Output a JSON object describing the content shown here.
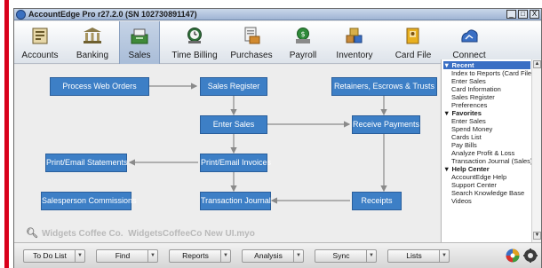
{
  "window": {
    "title": "AccountEdge Pro r27.2.0 (SN 102730891147)",
    "controls": [
      "_",
      "□",
      "X"
    ]
  },
  "toolbar": {
    "items": [
      {
        "label": "Accounts",
        "icon": "accounts-icon"
      },
      {
        "label": "Banking",
        "icon": "banking-icon"
      },
      {
        "label": "Sales",
        "icon": "sales-icon",
        "active": true
      },
      {
        "label": "Time Billing",
        "icon": "time-billing-icon"
      },
      {
        "label": "Purchases",
        "icon": "purchases-icon"
      },
      {
        "label": "Payroll",
        "icon": "payroll-icon"
      },
      {
        "label": "Inventory",
        "icon": "inventory-icon"
      },
      {
        "label": "Card File",
        "icon": "card-file-icon"
      },
      {
        "label": "Connect",
        "icon": "connect-icon"
      }
    ]
  },
  "flow": {
    "process_web_orders": "Process Web Orders",
    "sales_register": "Sales Register",
    "retainers": "Retainers, Escrows & Trusts",
    "enter_sales": "Enter Sales",
    "receive_payments": "Receive Payments",
    "print_email_statements": "Print/Email Statements",
    "print_email_invoices": "Print/Email Invoices",
    "salesperson_commissions": "Salesperson Commissions",
    "transaction_journal": "Transaction Journal",
    "receipts": "Receipts"
  },
  "company": {
    "name": "Widgets Coffee Co.",
    "file": "WidgetsCoffeeCo New UI.myo"
  },
  "sidebar": {
    "recent": {
      "heading": "Recent",
      "items": [
        "Index to Reports (Card File)",
        "Enter Sales",
        "Card Information",
        "Sales Register",
        "Preferences"
      ]
    },
    "favorites": {
      "heading": "Favorites",
      "items": [
        "Enter Sales",
        "Spend Money",
        "Cards List",
        "Pay Bills",
        "Analyze Profit & Loss",
        "Transaction Journal (Sales)"
      ]
    },
    "help": {
      "heading": "Help Center",
      "items": [
        "AccountEdge Help",
        "Support Center",
        "Search Knowledge Base",
        "Videos"
      ]
    }
  },
  "bottombar": {
    "buttons": [
      "To Do List",
      "Find",
      "Reports",
      "Analysis",
      "Sync",
      "Lists"
    ]
  },
  "colors": {
    "accent": "#d9001b",
    "flow_box": "#3d7fc6",
    "selection": "#3a6fc4"
  }
}
